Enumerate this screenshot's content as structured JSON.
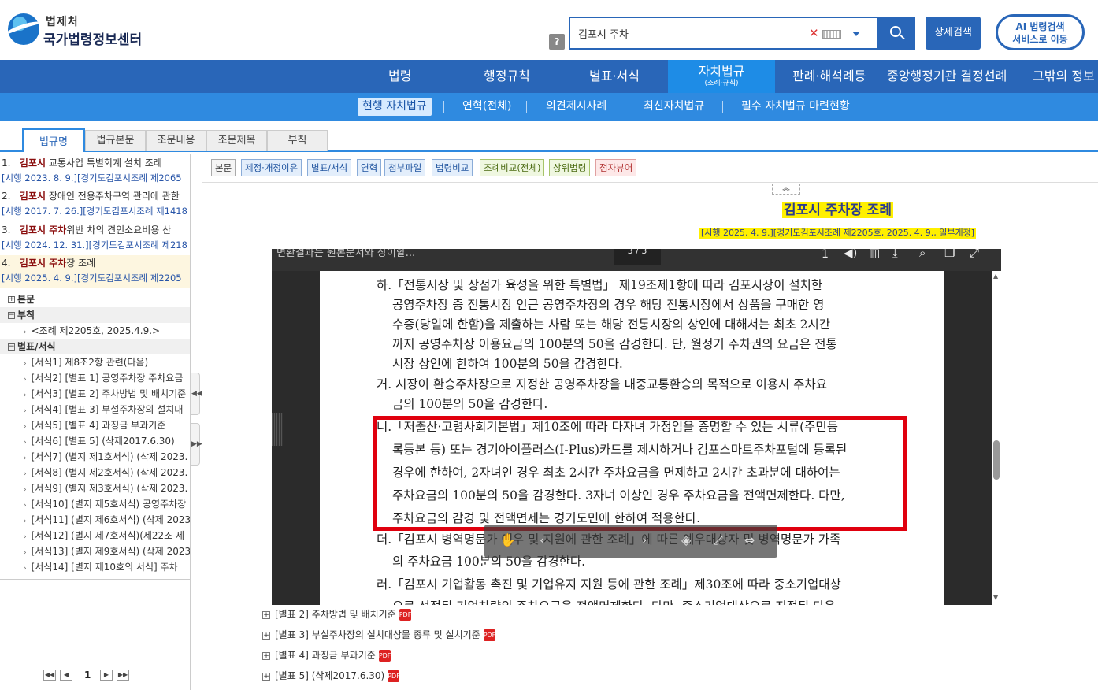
{
  "header": {
    "logo_line1": "법제처",
    "logo_line2": "국가법령정보센터",
    "help_label": "?",
    "search_value": "김포시 주차",
    "clear_glyph": "✕",
    "advanced_search": "상세검색",
    "ai_line1": "AI 법령검색",
    "ai_line2": "서비스로 이동"
  },
  "main_nav": [
    "법령",
    "행정규칙",
    "별표·서식",
    "자치법규",
    "판례·해석례등",
    "중앙행정기관 결정선례",
    "그밖의 정보"
  ],
  "main_nav_active_sub": "(조례·규칙)",
  "sub_nav": [
    "현행 자치법규",
    "연혁(전체)",
    "의견제시사례",
    "최신자치법규",
    "필수 자치법규 마련현황"
  ],
  "tabs": [
    "법규명",
    "법규본문",
    "조문내용",
    "조문제목",
    "부칙"
  ],
  "results": [
    {
      "num": "1.",
      "hl": "김포시",
      "title": " 교통사업 특별회계 설치 조례",
      "meta": "[시행 2023. 8. 9.][경기도김포시조례 제2065"
    },
    {
      "num": "2.",
      "hl": "김포시",
      "title": " 장애인 전용주차구역 관리에 관한",
      "meta": "[시행 2017. 7. 26.][경기도김포시조례 제1418"
    },
    {
      "num": "3.",
      "hl": "김포시 주차",
      "title": "위반 차의 견인소요비용 산",
      "meta": "[시행 2024. 12. 31.][경기도김포시조례 제218"
    },
    {
      "num": "4.",
      "hl": "김포시 주차",
      "title": "장 조례",
      "meta": "[시행 2025. 4. 9.][경기도김포시조례 제2205"
    }
  ],
  "tree": {
    "body": "본문",
    "appendix": "부칙",
    "appendix_item": "<조례 제2205호, 2025.4.9.>",
    "forms": "별표/서식",
    "form_items": [
      "[서식1] 제8조2항 관련(다음)",
      "[서식2] [별표 1] 공영주차장 주차요금",
      "[서식3] [별표 2] 주차방법 및 배치기준",
      "[서식4] [별표 3] 부설주차장의 설치대",
      "[서식5] [별표 4] 과징금 부과기준",
      "[서식6] [별표 5] (삭제2017.6.30)",
      "[서식7] (별지 제1호서식) (삭제 2023.",
      "[서식8] (별지 제2호서식) (삭제 2023.",
      "[서식9] (별지 제3호서식) (삭제 2023.",
      "[서식10] (별지 제5호서식) 공영주차장",
      "[서식11] (별지 제6호서식) (삭제 2023",
      "[서식12] (별지 제7호서식)(제22조 제",
      "[서식13] (별지 제9호서식) (삭제 2023",
      "[서식14] [별지 제10호의 서식] 주차"
    ]
  },
  "pager": {
    "first": "◀◀",
    "prev": "◀",
    "page": "1",
    "next": "▶",
    "last": "▶▶"
  },
  "toolbar": [
    "본문",
    "제정·개정이유",
    "별표/서식",
    "연혁",
    "첨부파일",
    "법령비교",
    "조례비교(전체)",
    "상위법령",
    "점자뷰어"
  ],
  "collapse": "︽",
  "doc": {
    "title": "김포시 주차장 조례",
    "meta": "[시행 2025. 4. 9.][경기도김포시조례 제2205호, 2025. 4. 9., 일부개정]"
  },
  "viewer": {
    "title": "변환결과는 원본문서와 상이할...",
    "page": "3 / 3",
    "lines_ha": [
      "하.「전통시장 및 상점가 육성을 위한 특별법」 제19조제1항에 따라 김포시장이 설치한",
      "공영주차장 중 전통시장 인근 공영주차장의 경우 해당 전통시장에서 상품을 구매한 영",
      "수증(당일에 한함)을 제출하는 사람 또는 해당 전통시장의 상인에 대해서는 최초 2시간",
      "까지 공영주차장 이용요금의 100분의 50을 감경한다. 단, 월정기 주차권의 요금은 전통",
      "시장 상인에 한하여 100분의 50을 감경한다."
    ],
    "lines_geo": [
      "거. 시장이 환승주차장으로 지정한 공영주차장을 대중교통환승의 목적으로 이용시 주차요",
      "금의 100분의 50을 감경한다."
    ],
    "lines_neo": [
      "너.「저출산·고령사회기본법」제10조에 따라 다자녀 가정임을 증명할 수 있는 서류(주민등",
      "록등본 등) 또는 경기아이플러스(I-Plus)카드를 제시하거나 김포스마트주차포털에 등록된",
      "경우에 한하여, 2자녀인 경우 최초 2시간 주차요금을 면제하고 2시간 초과분에 대하여는",
      "주차요금의 100분의 50을 감경한다. 3자녀 이상인 경우 주차요금을 전액면제한다. 다만,",
      "주차요금의 감경 및 전액면제는 경기도민에 한하여 적용한다."
    ],
    "lines_deo": [
      "더.「김포시 병역명문가 예우 및 지원에 관한 조례」에 따른 예우대상자 및 병역명문가 가족",
      "의 주차요금 100분의 50을 감경한다."
    ],
    "lines_reo": [
      "러.「김포시 기업활동 촉진 및 기업유지 지원 등에 관한 조례」제30조에 따라 중소기업대상",
      "으로 선정된 기업차량의 주차요금을 전액면제한다. 다만, 중소기업대상으로 지정된 다음"
    ]
  },
  "bottom_list": [
    "[별표 2] 주차방법 및 배치기준",
    "[별표 3] 부설주차장의 설치대상물 종류 및 설치기준",
    "[별표 4] 과징금 부과기준",
    "[별표 5] (삭제2017.6.30)"
  ],
  "colors": {
    "primary": "#2966b8",
    "subnav": "#2f8ae0",
    "highlight_red": "#e0000e",
    "title_yellow": "#fff000"
  }
}
